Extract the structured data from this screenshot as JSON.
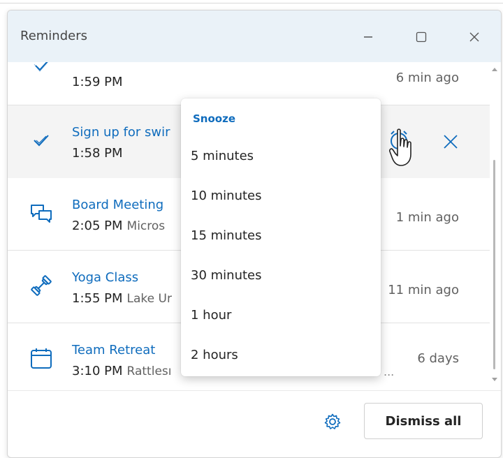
{
  "window": {
    "title": "Reminders"
  },
  "reminders": [
    {
      "title": "",
      "time": "1:59 PM",
      "location": "",
      "due": "6 min ago",
      "icon": "task-check-icon"
    },
    {
      "title": "Sign up for swir",
      "time": "1:58 PM",
      "location": "",
      "due": "",
      "icon": "task-check-icon"
    },
    {
      "title": "Board Meeting",
      "time": "2:05 PM",
      "location": "Micros",
      "due": "1 min ago",
      "icon": "chat-bubbles-icon"
    },
    {
      "title": "Yoga Class",
      "time": "1:55 PM",
      "location": "Lake Ur",
      "due": "11 min ago",
      "icon": "dumbbell-icon"
    },
    {
      "title": "Team Retreat",
      "time": "3:10 PM",
      "location": "Rattlesı",
      "due": "6 days",
      "icon": "calendar-icon"
    }
  ],
  "snooze_menu": {
    "header": "Snooze",
    "options": [
      "5 minutes",
      "10 minutes",
      "15 minutes",
      "30 minutes",
      "1 hour",
      "2 hours"
    ]
  },
  "footer": {
    "dismiss_all_label": "Dismiss all",
    "ellipsis": "..."
  },
  "colors": {
    "accent": "#0f6cbd",
    "titlebar": "#eaf2f8"
  }
}
